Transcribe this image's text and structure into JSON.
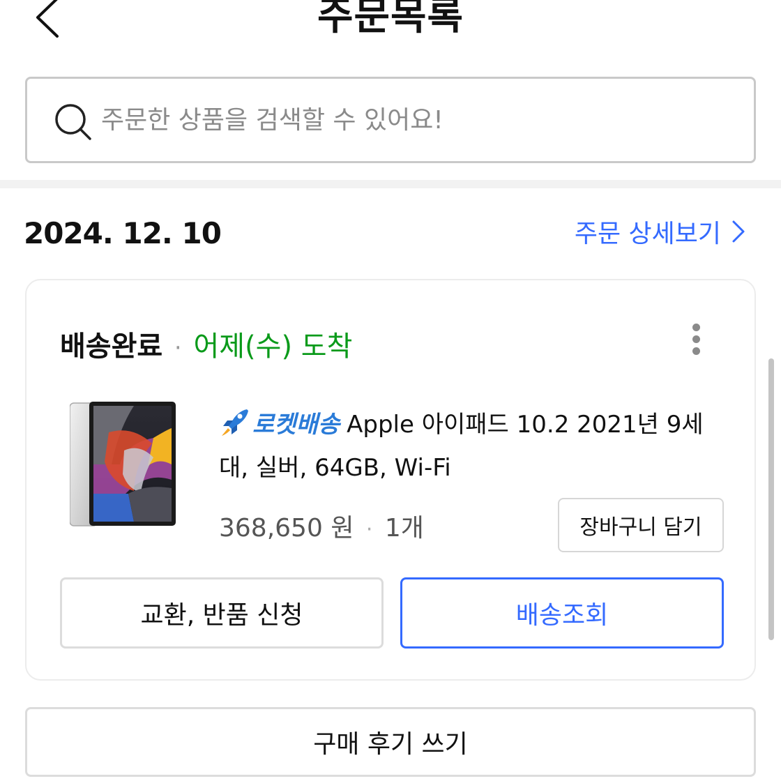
{
  "header": {
    "title": "주문목록"
  },
  "search": {
    "placeholder": "주문한 상품을 검색할 수 있어요!",
    "value": ""
  },
  "order": {
    "date": "2024. 12. 10",
    "detail_link": "주문 상세보기",
    "status": "배송완료",
    "status_separator": "·",
    "arrival": "어제(수) 도착",
    "product": {
      "rocket_label": "로켓배송",
      "name": "Apple 아이패드 10.2 2021년 9세대, 실버, 64GB, Wi-Fi",
      "price": "368,650 원",
      "quantity": "1개",
      "separator": "·"
    },
    "buttons": {
      "cart": "장바구니 담기",
      "exchange": "교환, 반품 신청",
      "tracking": "배송조회"
    }
  },
  "review_button": "구매 후기 쓰기",
  "colors": {
    "accent_blue": "#346aff",
    "arrival_green": "#0a9a1a",
    "rocket_blue": "#2a7bd8"
  },
  "icons": {
    "back": "chevron-left-icon",
    "search": "search-icon",
    "detail_link": "chevron-right-icon",
    "more": "more-vertical-icon",
    "rocket": "rocket-icon"
  }
}
